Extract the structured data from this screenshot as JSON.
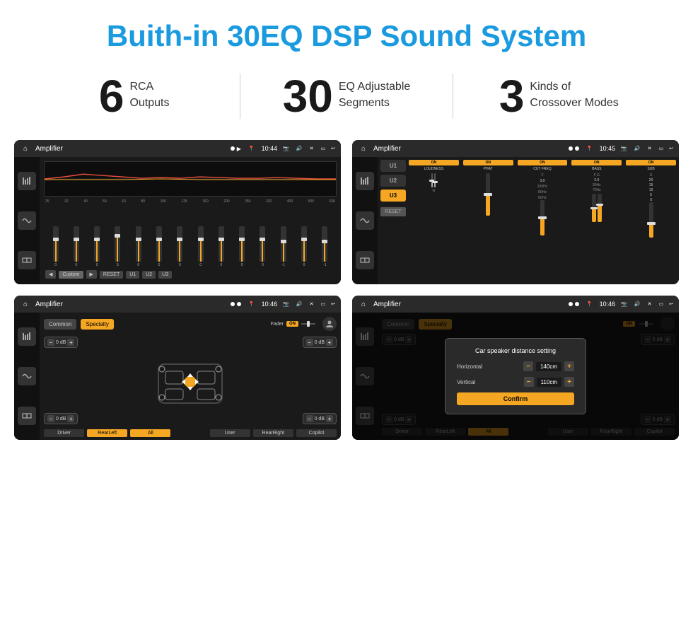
{
  "page": {
    "title": "Buith-in 30EQ DSP Sound System",
    "stats": [
      {
        "number": "6",
        "desc_line1": "RCA",
        "desc_line2": "Outputs"
      },
      {
        "number": "30",
        "desc_line1": "EQ Adjustable",
        "desc_line2": "Segments"
      },
      {
        "number": "3",
        "desc_line1": "Kinds of",
        "desc_line2": "Crossover Modes"
      }
    ]
  },
  "screen_eq": {
    "status_title": "Amplifier",
    "status_time": "10:44",
    "freqs": [
      "25",
      "32",
      "40",
      "50",
      "63",
      "80",
      "100",
      "125",
      "160",
      "200",
      "250",
      "320",
      "400",
      "500",
      "630"
    ],
    "values": [
      "0",
      "0",
      "0",
      "5",
      "0",
      "0",
      "0",
      "0",
      "0",
      "0",
      "0",
      "-1",
      "0",
      "-1"
    ],
    "buttons": [
      "Custom",
      "RESET",
      "U1",
      "U2",
      "U3"
    ]
  },
  "screen_crossover": {
    "status_title": "Amplifier",
    "status_time": "10:45",
    "presets": [
      "U1",
      "U2",
      "U3"
    ],
    "channels": [
      {
        "name": "LOUDNESS",
        "on": true
      },
      {
        "name": "PHAT",
        "on": true
      },
      {
        "name": "CUT FREQ",
        "on": true
      },
      {
        "name": "BASS",
        "on": true
      },
      {
        "name": "SUB",
        "on": true
      }
    ],
    "reset_label": "RESET"
  },
  "screen_fader": {
    "status_title": "Amplifier",
    "status_time": "10:46",
    "tabs": [
      "Common",
      "Specialty"
    ],
    "fader_label": "Fader",
    "on_label": "ON",
    "volumes": [
      {
        "label": "0 dB"
      },
      {
        "label": "0 dB"
      },
      {
        "label": "0 dB"
      },
      {
        "label": "0 dB"
      }
    ],
    "buttons": [
      "Driver",
      "RearLeft",
      "All",
      "User",
      "RearRight",
      "Copilot"
    ]
  },
  "screen_dialog": {
    "status_title": "Amplifier",
    "status_time": "10:46",
    "tabs": [
      "Common",
      "Specialty"
    ],
    "on_label": "ON",
    "dialog": {
      "title": "Car speaker distance setting",
      "horizontal_label": "Horizontal",
      "horizontal_value": "140cm",
      "vertical_label": "Vertical",
      "vertical_value": "110cm",
      "confirm_label": "Confirm"
    },
    "bottom_btns": [
      "RearLeft",
      "All",
      "User",
      "RearRight"
    ]
  }
}
